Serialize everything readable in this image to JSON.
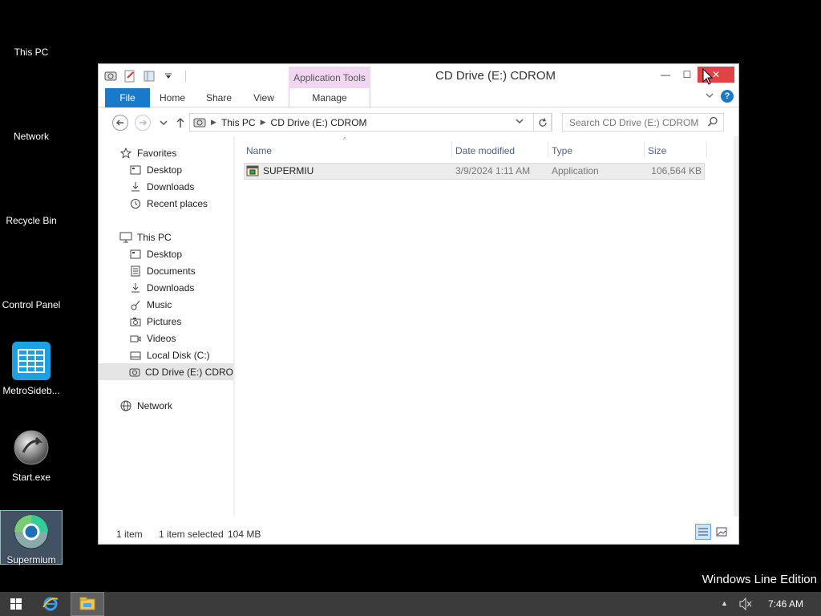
{
  "desktop": {
    "icons": [
      {
        "label": "This PC"
      },
      {
        "label": "Network"
      },
      {
        "label": "Recycle Bin"
      },
      {
        "label": "Control Panel"
      },
      {
        "label": "MetroSideb..."
      },
      {
        "label": "Start.exe"
      },
      {
        "label": "Supermium"
      }
    ],
    "brand": "Windows Line Edition"
  },
  "window": {
    "title": "CD Drive (E:) CDROM",
    "context_tab": "Application Tools",
    "controls": {
      "minimize": "—",
      "maximize": "☐",
      "close": "✕"
    },
    "ribbon_tabs": [
      "File",
      "Home",
      "Share",
      "View",
      "Manage"
    ],
    "address": {
      "crumbs": [
        "This PC",
        "CD Drive (E:) CDROM"
      ]
    },
    "search": {
      "placeholder": "Search CD Drive (E:) CDROM"
    },
    "nav": {
      "favorites_label": "Favorites",
      "favorites": [
        "Desktop",
        "Downloads",
        "Recent places"
      ],
      "thispc_label": "This PC",
      "thispc": [
        "Desktop",
        "Documents",
        "Downloads",
        "Music",
        "Pictures",
        "Videos",
        "Local Disk (C:)",
        "CD Drive (E:) CDROM"
      ],
      "network_label": "Network"
    },
    "columns": [
      "Name",
      "Date modified",
      "Type",
      "Size"
    ],
    "files": [
      {
        "name": "SUPERMIU",
        "date": "3/9/2024 1:11 AM",
        "type": "Application",
        "size": "106,564 KB"
      }
    ],
    "status": {
      "count": "1 item",
      "selected": "1 item selected",
      "size": "104 MB"
    }
  },
  "taskbar": {
    "time": "7:46 AM"
  },
  "colors": {
    "accent": "#1979ca",
    "context": "#f1d6f1",
    "close": "#e04343",
    "taskbar": "#3b3b3b"
  }
}
